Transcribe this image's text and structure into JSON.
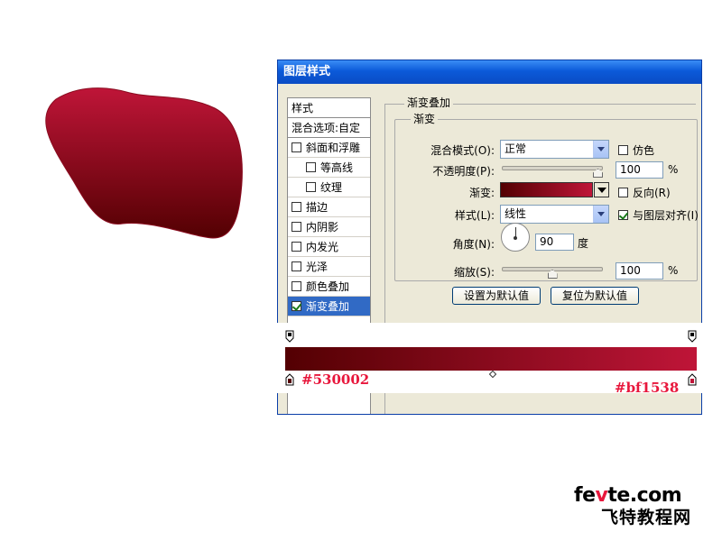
{
  "colors": {
    "gradient_start": "#530002",
    "gradient_end": "#bf1538",
    "hex_label_color": "#e8173c",
    "titlebar": "#0b5ad9",
    "selected_row": "#316ac5"
  },
  "dialog": {
    "title": "图层样式"
  },
  "styles_list": {
    "items": [
      {
        "label": "样式",
        "checkbox": false,
        "checked": false
      },
      {
        "label": "混合选项:自定",
        "checkbox": false,
        "checked": false
      },
      {
        "label": "斜面和浮雕",
        "checkbox": true,
        "checked": false
      },
      {
        "label": "等高线",
        "checkbox": true,
        "checked": false
      },
      {
        "label": "纹理",
        "checkbox": true,
        "checked": false
      },
      {
        "label": "描边",
        "checkbox": true,
        "checked": false
      },
      {
        "label": "内阴影",
        "checkbox": true,
        "checked": false
      },
      {
        "label": "内发光",
        "checkbox": true,
        "checked": false
      },
      {
        "label": "光泽",
        "checkbox": true,
        "checked": false
      },
      {
        "label": "颜色叠加",
        "checkbox": true,
        "checked": false
      },
      {
        "label": "渐变叠加",
        "checkbox": true,
        "checked": true,
        "selected": true
      }
    ]
  },
  "gradient_overlay": {
    "section_title": "渐变叠加",
    "group_title": "渐变",
    "blend_mode_label": "混合模式(O):",
    "blend_mode_value": "正常",
    "dither_label": "仿色",
    "dither_checked": false,
    "opacity_label": "不透明度(P):",
    "opacity_value": "100",
    "opacity_unit": "%",
    "opacity_level": 1.0,
    "gradient_label": "渐变:",
    "reverse_label": "反向(R)",
    "reverse_checked": false,
    "style_label": "样式(L):",
    "style_value": "线性",
    "align_label": "与图层对齐(I)",
    "align_checked": true,
    "angle_label": "角度(N):",
    "angle_value": "90",
    "angle_unit": "度",
    "scale_label": "缩放(S):",
    "scale_value": "100",
    "scale_unit": "%",
    "scale_level": 0.5,
    "reset_default_button": "设置为默认值",
    "restore_default_button": "复位为默认值"
  },
  "gradient_editor": {
    "left_stop_hex": "#530002",
    "right_stop_hex": "#bf1538"
  },
  "watermark": {
    "line1_pre": "fe",
    "line1_v": "v",
    "line1_post": "te.com",
    "line2": "飞特教程网"
  }
}
